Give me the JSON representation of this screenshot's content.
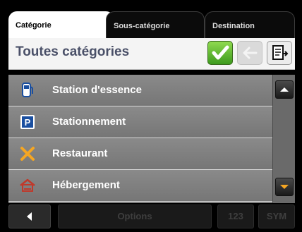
{
  "tabs": [
    {
      "label": "Catégorie",
      "active": true
    },
    {
      "label": "Sous-catégorie",
      "active": false
    },
    {
      "label": "Destination",
      "active": false
    }
  ],
  "header": {
    "title": "Toutes catégories"
  },
  "toolbar": {
    "confirm_icon": "checkmark-icon",
    "back_icon": "arrow-left-icon",
    "sort_icon": "sort-list-icon"
  },
  "list": {
    "items": [
      {
        "label": "Station d'essence",
        "icon": "fuel-pump-icon"
      },
      {
        "label": "Stationnement",
        "icon": "parking-icon"
      },
      {
        "label": "Restaurant",
        "icon": "fork-knife-icon"
      },
      {
        "label": "Hébergement",
        "icon": "hotel-bed-icon"
      }
    ]
  },
  "bottom_bar": {
    "back_icon": "triangle-left-icon",
    "options_label": "Options",
    "numeric_label": "123",
    "symbol_label": "SYM"
  },
  "colors": {
    "accent": "#f5a623",
    "title_text": "#4a5068",
    "confirm_green": "#5cb82e"
  }
}
